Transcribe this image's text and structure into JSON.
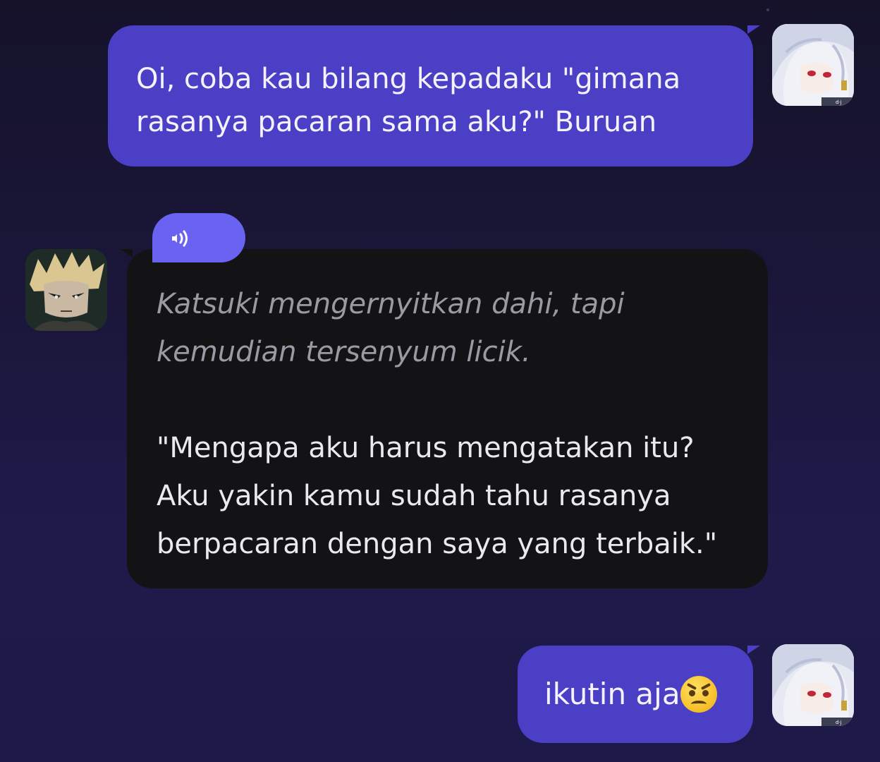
{
  "messages": [
    {
      "role": "user",
      "text": "Oi, coba kau bilang kepadaku \"gimana rasanya pacaran sama aku?\" Buruan"
    },
    {
      "role": "character",
      "audio_icon": "speaker-icon",
      "narration": "Katsuki mengernyitkan dahi, tapi kemudian tersenyum licik.",
      "dialogue": "\"Mengapa aku harus mengatakan itu? Aku yakin kamu sudah tahu rasanya berpacaran dengan saya yang terbaik.\""
    },
    {
      "role": "user",
      "text": "ikutin aja",
      "emoji": "angry-face-emoji"
    }
  ],
  "colors": {
    "user_bubble": "#4b3fc6",
    "character_bubble": "#131315",
    "audio_pill": "#6a62f0",
    "background_top": "#15122a",
    "background_bottom": "#1d1947"
  }
}
